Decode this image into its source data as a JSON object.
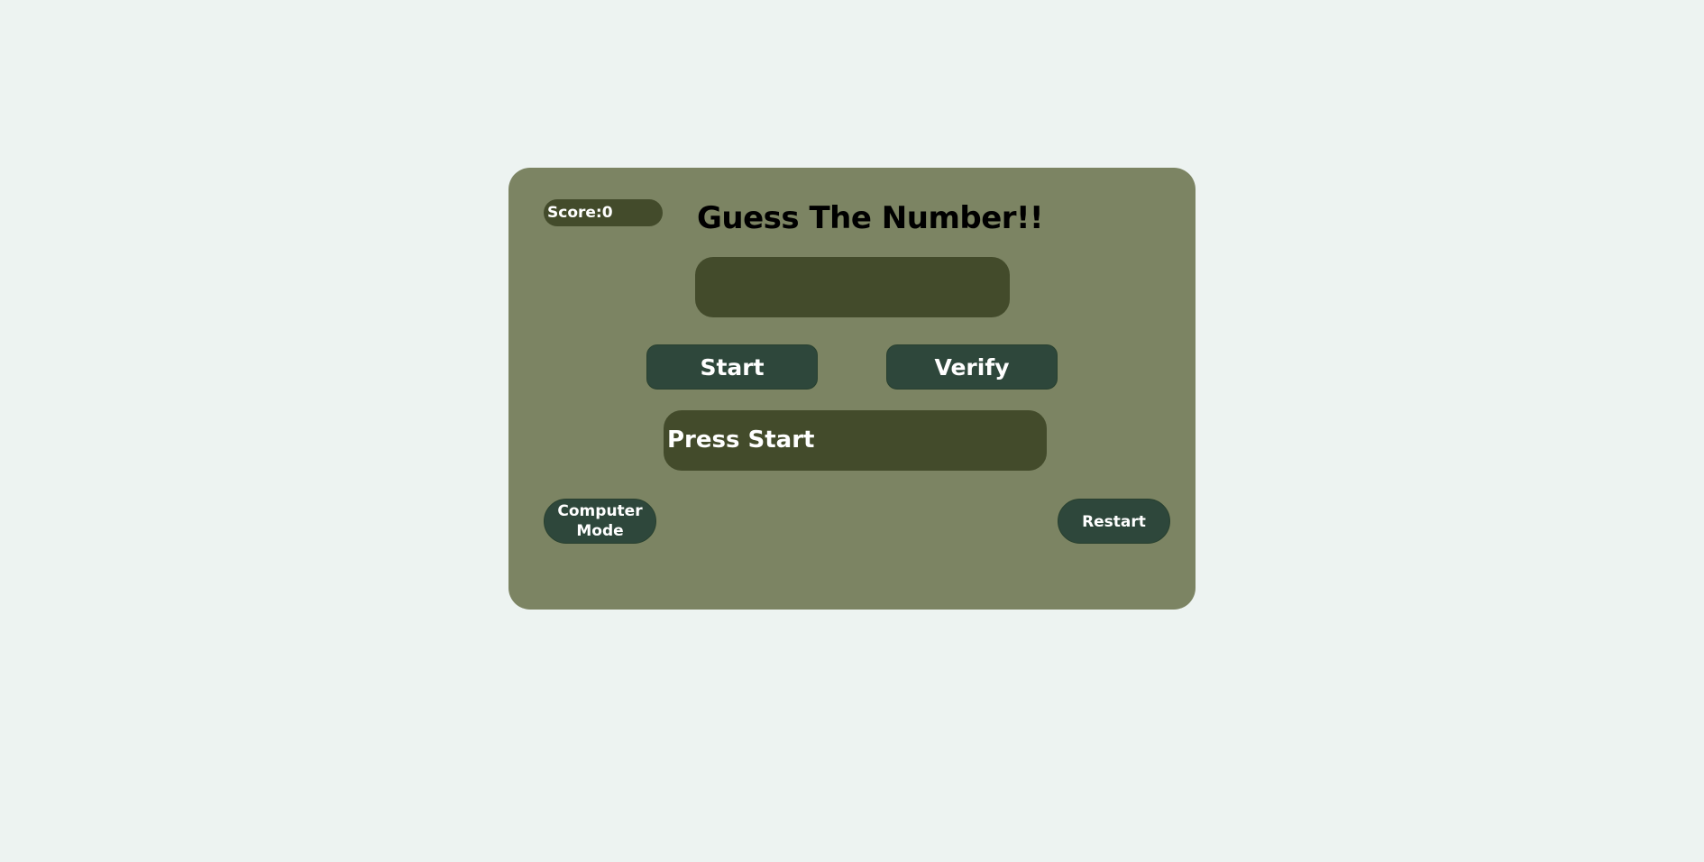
{
  "game": {
    "score_text": "Score:0",
    "title": "Guess The Number!!",
    "guess_value": "",
    "start_label": "Start",
    "verify_label": "Verify",
    "message": "Press Start",
    "computer_mode_label": "Computer Mode",
    "restart_label": "Restart"
  },
  "colors": {
    "page_background": "#edf3f1",
    "card_background": "#7c8463",
    "field_background": "#434b2b",
    "button_background": "#2e473b",
    "text_light": "#ffffff",
    "title_text": "#000000"
  }
}
